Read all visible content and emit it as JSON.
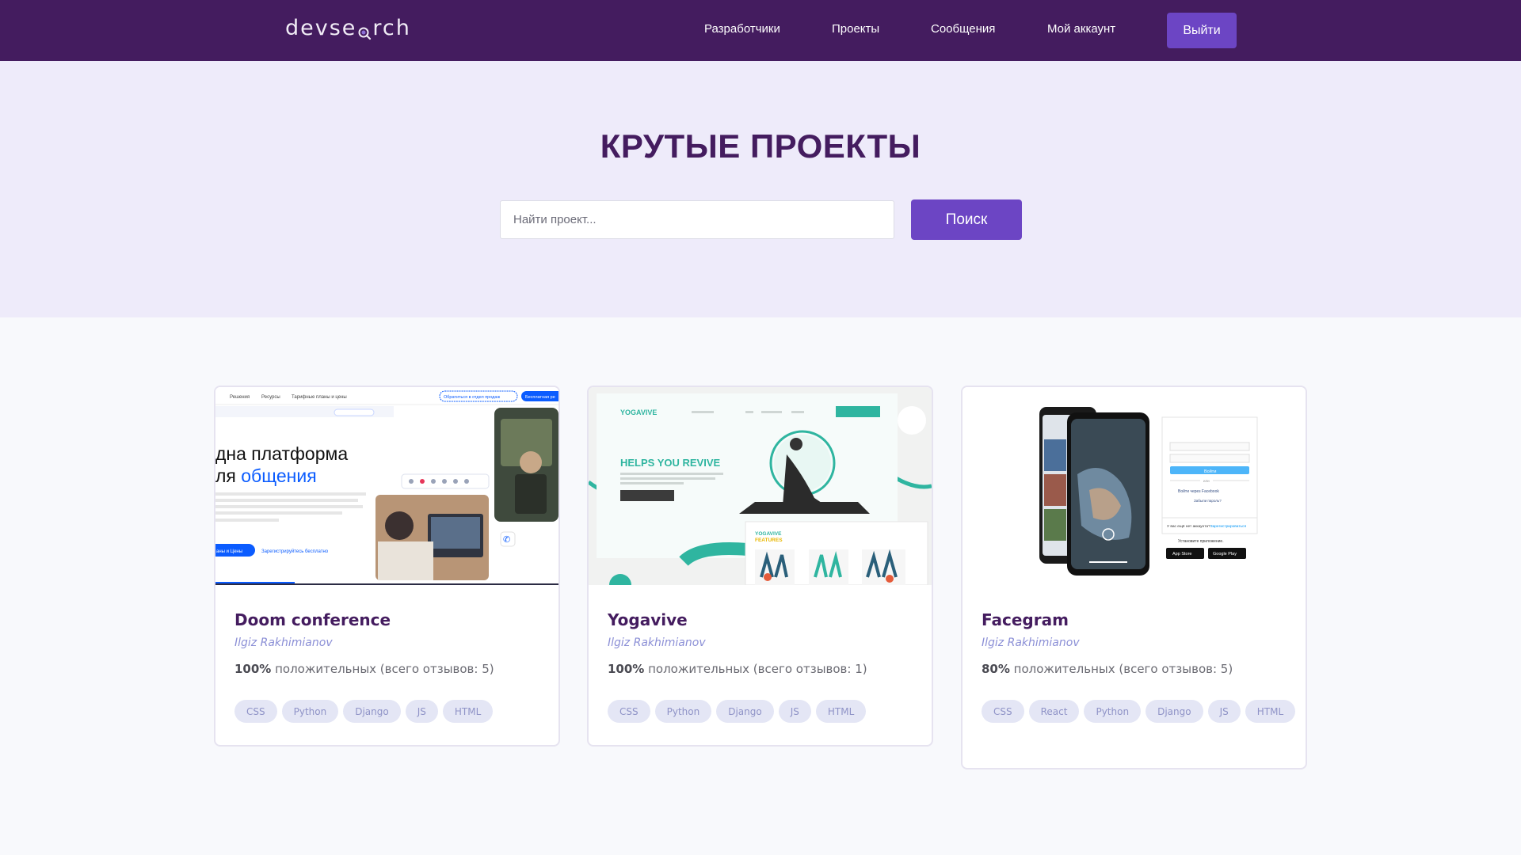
{
  "header": {
    "logo": {
      "prefix": "devse",
      "suffix": "rch"
    },
    "nav": {
      "developers": "Разработчики",
      "projects": "Проекты",
      "messages": "Сообщения",
      "account": "Мой аккаунт",
      "logout": "Выйти"
    }
  },
  "hero": {
    "title_light": "КРУТЫЕ ",
    "title_bold": "ПРОЕКТЫ",
    "search_placeholder": "Найти проект...",
    "search_button": "Поиск"
  },
  "projects": [
    {
      "title": "Doom conference",
      "author": "Ilgiz Rakhimianov",
      "rating_percent": "100%",
      "rating_text": " положительных (всего отзывов: 5)",
      "tags": [
        "CSS",
        "Python",
        "Django",
        "JS",
        "HTML"
      ],
      "thumbnail": {
        "nav": [
          "Решения",
          "Ресурсы",
          "Тарифные планы и цены"
        ],
        "cta_sales": "Обратиться в отдел продаж",
        "cta_free": "Бесплатная ре",
        "headline_1": "дна платформа",
        "headline_2_prefix": "ля ",
        "headline_2_accent": "общения",
        "btn_primary": "аны и Цены",
        "btn_link": "Зарегистрируйтесь бесплатно"
      }
    },
    {
      "title": "Yogavive",
      "author": "Ilgiz Rakhimianov",
      "rating_percent": "100%",
      "rating_text": " положительных (всего отзывов: 1)",
      "tags": [
        "CSS",
        "Python",
        "Django",
        "JS",
        "HTML"
      ],
      "thumbnail": {
        "brand": "YOGAVIVE",
        "headline": "HELPS YOU REVIVE",
        "features_1": "YOGAVIVE",
        "features_2": "FEATURES"
      }
    },
    {
      "title": "Facegram",
      "author": "Ilgiz Rakhimianov",
      "rating_percent": "80%",
      "rating_text": " положительных (всего отзывов: 5)",
      "tags": [
        "CSS",
        "React",
        "Python",
        "Django",
        "JS",
        "HTML"
      ],
      "thumbnail": {
        "login_button": "Войти",
        "or": "или",
        "facebook": "Войти через Facebook",
        "forgot": "Забыли пароль?",
        "no_account": "У вас ещё нет аккаунта?",
        "register": "Зарегистрироваться",
        "install": "Установите приложение.",
        "app_store": "App Store",
        "google_play": "Google Play"
      }
    }
  ],
  "colors": {
    "header_bg": "#441c5f",
    "accent": "#6c45c4",
    "hero_bg": "#eeebfa",
    "tag_bg": "#e4e6f5",
    "tag_text": "#8f93c7",
    "author": "#8b8fd6"
  }
}
